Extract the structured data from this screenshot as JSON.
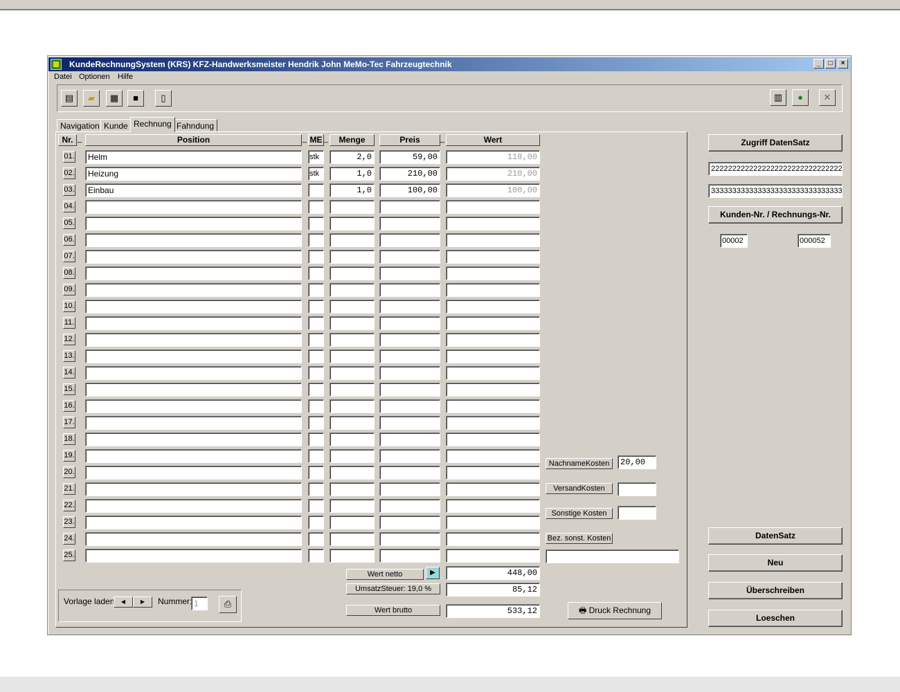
{
  "window": {
    "title": "KundeRechnungSystem (KRS)  KFZ-Handwerksmeister  Hendrik John  MeMo-Tec Fahrzeugtechnik"
  },
  "menu": [
    "Datei",
    "Optionen",
    "Hilfe"
  ],
  "tabs": [
    "Navigation",
    "Kunde",
    "Rechnung",
    "Fahndung"
  ],
  "active_tab": "Rechnung",
  "columns": {
    "nr": "Nr.",
    "position": "Position",
    "me": "ME",
    "menge": "Menge",
    "preis": "Preis",
    "wert": "Wert"
  },
  "rows": [
    {
      "nr": "01.",
      "position": "Helm",
      "me": "stk",
      "menge": "2,0",
      "preis": "59,00",
      "wert": "118,00"
    },
    {
      "nr": "02.",
      "position": "Heizung",
      "me": "stk",
      "menge": "1,0",
      "preis": "210,00",
      "wert": "210,00"
    },
    {
      "nr": "03.",
      "position": "Einbau",
      "me": "",
      "menge": "1,0",
      "preis": "100,00",
      "wert": "100,00"
    },
    {
      "nr": "04.",
      "position": "",
      "me": "",
      "menge": "",
      "preis": "",
      "wert": ""
    },
    {
      "nr": "05.",
      "position": "",
      "me": "",
      "menge": "",
      "preis": "",
      "wert": ""
    },
    {
      "nr": "06.",
      "position": "",
      "me": "",
      "menge": "",
      "preis": "",
      "wert": ""
    },
    {
      "nr": "07.",
      "position": "",
      "me": "",
      "menge": "",
      "preis": "",
      "wert": ""
    },
    {
      "nr": "08.",
      "position": "",
      "me": "",
      "menge": "",
      "preis": "",
      "wert": ""
    },
    {
      "nr": "09.",
      "position": "",
      "me": "",
      "menge": "",
      "preis": "",
      "wert": ""
    },
    {
      "nr": "10.",
      "position": "",
      "me": "",
      "menge": "",
      "preis": "",
      "wert": ""
    },
    {
      "nr": "11.",
      "position": "",
      "me": "",
      "menge": "",
      "preis": "",
      "wert": ""
    },
    {
      "nr": "12.",
      "position": "",
      "me": "",
      "menge": "",
      "preis": "",
      "wert": ""
    },
    {
      "nr": "13.",
      "position": "",
      "me": "",
      "menge": "",
      "preis": "",
      "wert": ""
    },
    {
      "nr": "14.",
      "position": "",
      "me": "",
      "menge": "",
      "preis": "",
      "wert": ""
    },
    {
      "nr": "15.",
      "position": "",
      "me": "",
      "menge": "",
      "preis": "",
      "wert": ""
    },
    {
      "nr": "16.",
      "position": "",
      "me": "",
      "menge": "",
      "preis": "",
      "wert": ""
    },
    {
      "nr": "17.",
      "position": "",
      "me": "",
      "menge": "",
      "preis": "",
      "wert": ""
    },
    {
      "nr": "18.",
      "position": "",
      "me": "",
      "menge": "",
      "preis": "",
      "wert": ""
    },
    {
      "nr": "19.",
      "position": "",
      "me": "",
      "menge": "",
      "preis": "",
      "wert": ""
    },
    {
      "nr": "20.",
      "position": "",
      "me": "",
      "menge": "",
      "preis": "",
      "wert": ""
    },
    {
      "nr": "21.",
      "position": "",
      "me": "",
      "menge": "",
      "preis": "",
      "wert": ""
    },
    {
      "nr": "22.",
      "position": "",
      "me": "",
      "menge": "",
      "preis": "",
      "wert": ""
    },
    {
      "nr": "23.",
      "position": "",
      "me": "",
      "menge": "",
      "preis": "",
      "wert": ""
    },
    {
      "nr": "24.",
      "position": "",
      "me": "",
      "menge": "",
      "preis": "",
      "wert": ""
    },
    {
      "nr": "25.",
      "position": "",
      "me": "",
      "menge": "",
      "preis": "",
      "wert": ""
    }
  ],
  "costs": {
    "nachname_label": "NachnameKosten",
    "nachname_value": "20,00",
    "versand_label": "VersandKosten",
    "versand_value": "",
    "sonstige_label": "Sonstige Kosten",
    "sonstige_value": "",
    "bez_label": "Bez. sonst. Kosten",
    "bez_value": ""
  },
  "totals": {
    "netto_label": "Wert netto",
    "netto_value": "448,00",
    "ust_label": "UmsatzSteuer: 19,0 %",
    "ust_value": "85,12",
    "brutto_label": "Wert brutto",
    "brutto_value": "533,12"
  },
  "print_button": "Druck Rechnung",
  "vorlage": {
    "label": "Vorlage laden",
    "nummer_label": "Nummer:",
    "nummer_value": "1"
  },
  "right": {
    "zugriff_label": "Zugriff DatenSatz",
    "field1": "2222222222222222222222222222222",
    "field2": "3333333333333333333333333333333",
    "kunden_label": "Kunden-Nr. / Rechnungs-Nr.",
    "kunden_nr": "00002",
    "rechnungs_nr": "000052",
    "datensatz_label": "DatenSatz",
    "neu": "Neu",
    "ueberschreiben": "Überschreiben",
    "loeschen": "Loeschen"
  }
}
